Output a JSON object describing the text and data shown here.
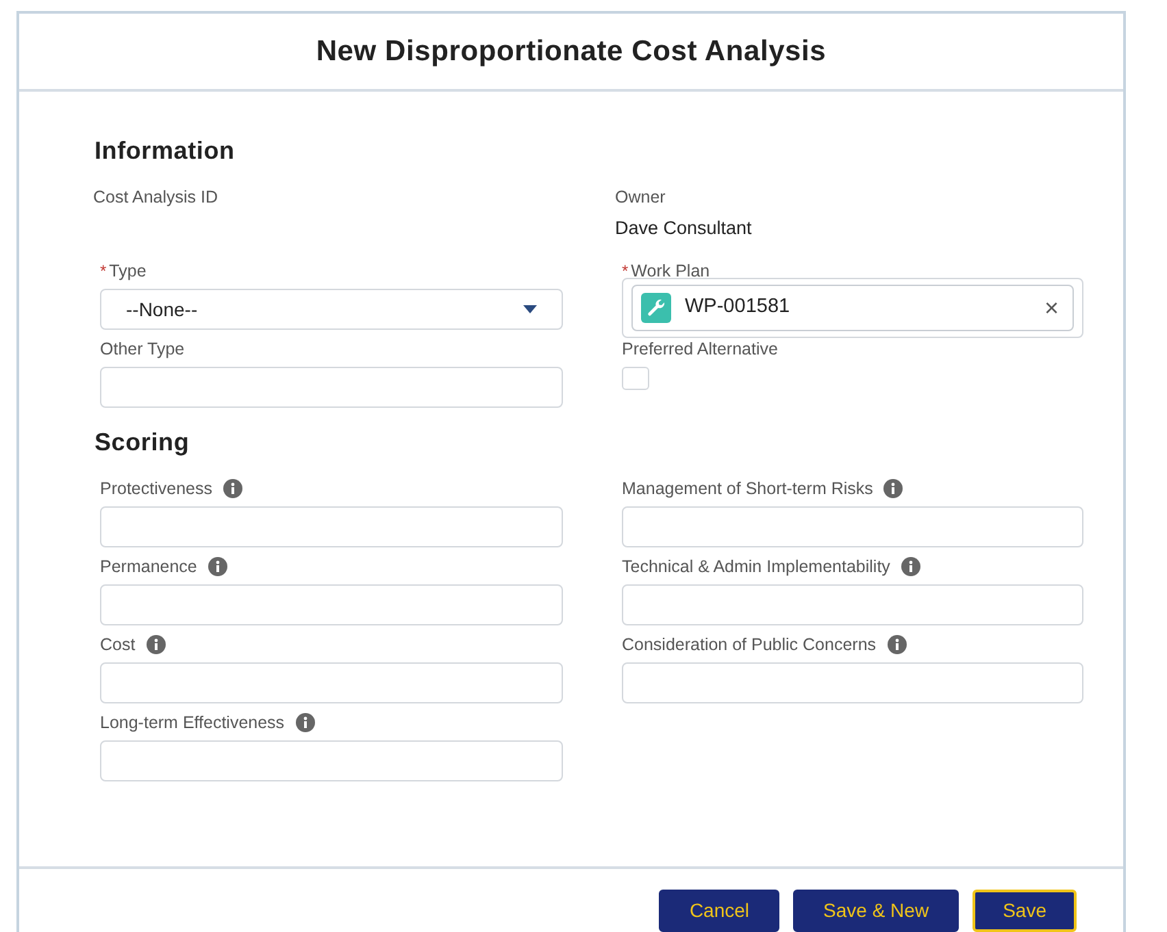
{
  "title": "New Disproportionate Cost Analysis",
  "sections": [
    {
      "title": "Information",
      "fields": [
        {
          "kind": "readonly",
          "label": "Cost Analysis ID"
        },
        {
          "kind": "readonly",
          "label": "Owner",
          "value": "Dave Consultant"
        },
        {
          "kind": "select",
          "label": "Type",
          "required_mark": "*",
          "value": "--None--"
        },
        {
          "kind": "lookup",
          "label": "Work Plan",
          "required_mark": "*",
          "value": "WP-001581",
          "clear": "×"
        },
        {
          "kind": "text",
          "label": "Other Type"
        },
        {
          "kind": "checkbox",
          "label": "Preferred Alternative",
          "checked": false
        }
      ]
    },
    {
      "title": "Scoring",
      "fields": [
        {
          "kind": "text",
          "label": "Protectiveness",
          "info": true
        },
        {
          "kind": "text",
          "label": "Management of Short-term Risks",
          "info": true
        },
        {
          "kind": "text",
          "label": "Permanence",
          "info": true
        },
        {
          "kind": "text",
          "label": "Technical & Admin Implementability",
          "info": true
        },
        {
          "kind": "text",
          "label": "Cost",
          "info": true
        },
        {
          "kind": "text",
          "label": "Consideration of Public Concerns",
          "info": true
        },
        {
          "kind": "text",
          "label": "Long-term Effectiveness",
          "info": true
        }
      ]
    }
  ],
  "buttons": [
    {
      "label": "Cancel",
      "focused": false
    },
    {
      "label": "Save & New",
      "focused": false
    },
    {
      "label": "Save",
      "focused": true
    }
  ]
}
